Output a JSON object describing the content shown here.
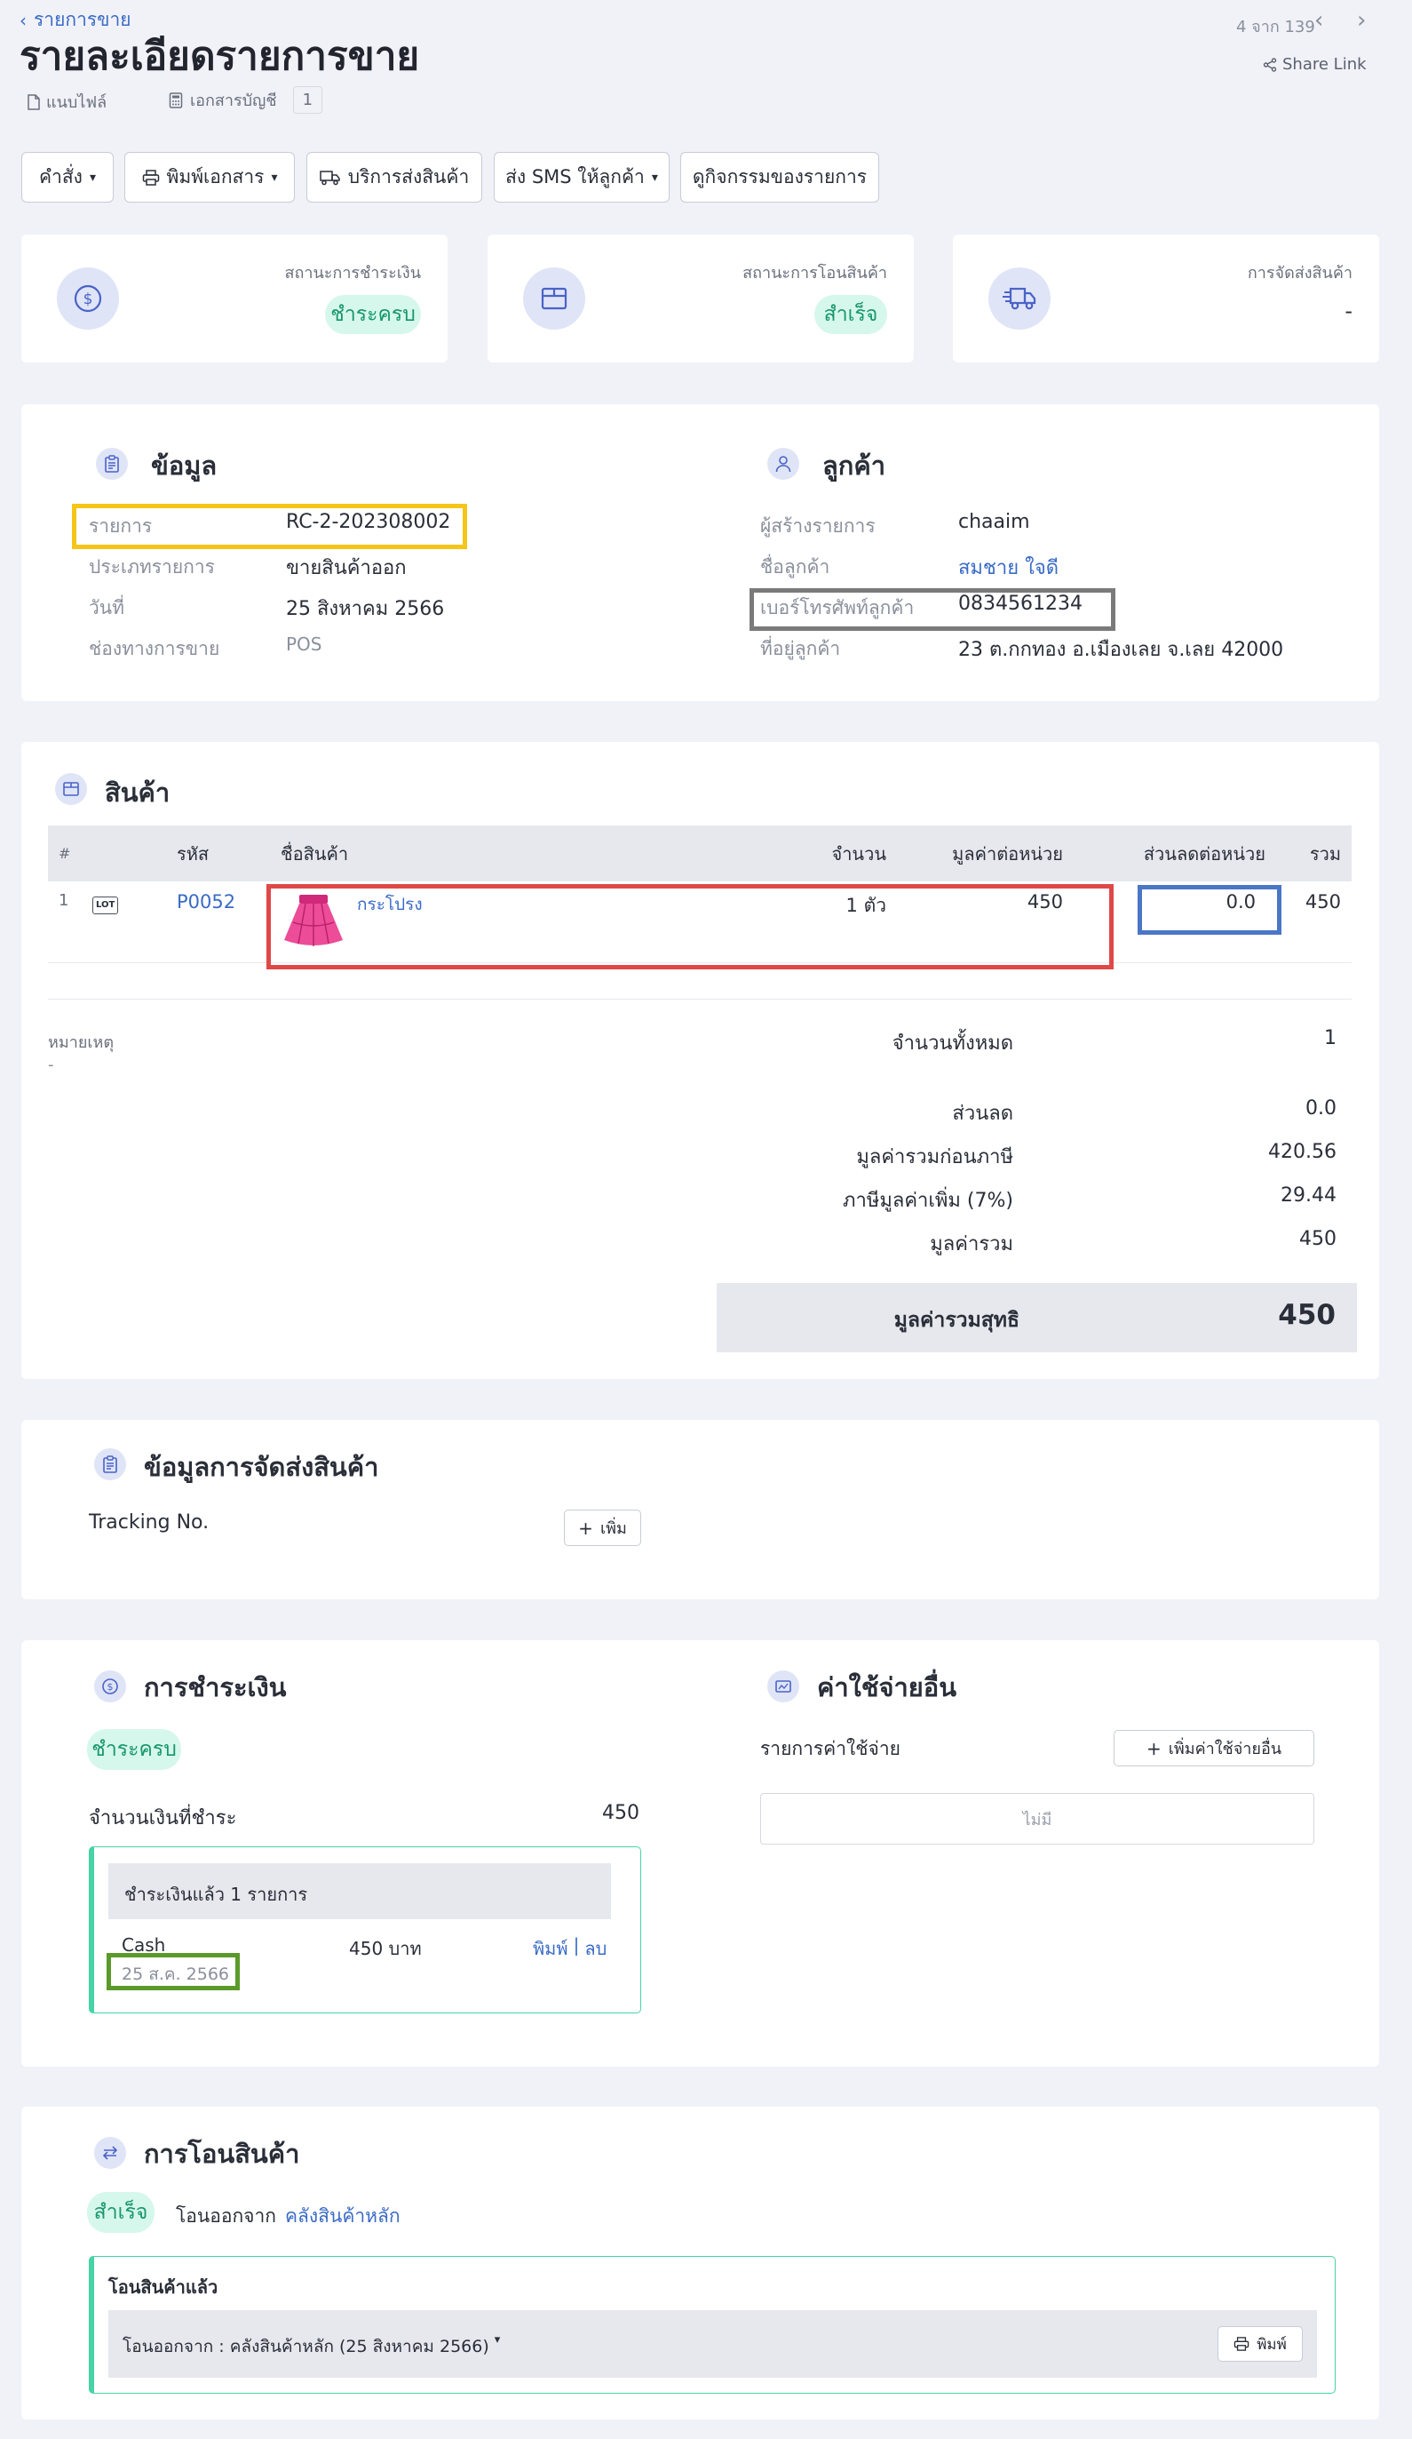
{
  "header": {
    "back_link": "รายการขาย",
    "title": "รายละเอียดรายการขาย",
    "attach_label": "แนบไฟล์",
    "accounting_label": "เอกสารบัญชี",
    "accounting_count": "1",
    "pager": "4 จาก 139",
    "share_link": "Share Link"
  },
  "toolbar": {
    "command": "คำสั่ง",
    "print_docs": "พิมพ์เอกสาร",
    "shipping_service": "บริการส่งสินค้า",
    "send_sms": "ส่ง SMS ให้ลูกค้า",
    "activity": "ดูกิจกรรมของรายการ"
  },
  "status_cards": [
    {
      "label": "สถานะการชำระเงิน",
      "value": "ชำระครบ",
      "icon": "dollar-icon"
    },
    {
      "label": "สถานะการโอนสินค้า",
      "value": "สำเร็จ",
      "icon": "box-icon"
    },
    {
      "label": "การจัดส่งสินค้า",
      "value": "-",
      "icon": "truck-icon"
    }
  ],
  "info": {
    "title": "ข้อมูล",
    "rows": [
      {
        "label": "รายการ",
        "value": "RC-2-202308002"
      },
      {
        "label": "ประเภทรายการ",
        "value": "ขายสินค้าออก"
      },
      {
        "label": "วันที่",
        "value": "25 สิงหาคม 2566"
      },
      {
        "label": "ช่องทางการขาย",
        "value": "POS"
      }
    ]
  },
  "customer": {
    "title": "ลูกค้า",
    "rows": [
      {
        "label": "ผู้สร้างรายการ",
        "value": "chaaim"
      },
      {
        "label": "ชื่อลูกค้า",
        "value": "สมชาย ใจดี"
      },
      {
        "label": "เบอร์โทรศัพท์ลูกค้า",
        "value": "0834561234"
      },
      {
        "label": "ที่อยู่ลูกค้า",
        "value": "23 ต.กกทอง อ.เมืองเลย จ.เลย 42000"
      }
    ]
  },
  "products": {
    "title": "สินค้า",
    "columns": [
      "#",
      "รหัส",
      "ชื่อสินค้า",
      "จำนวน",
      "มูลค่าต่อหน่วย",
      "ส่วนลดต่อหน่วย",
      "รวม"
    ],
    "rows": [
      {
        "index": "1",
        "lot": "LOT",
        "code": "P0052",
        "name": "กระโปรง",
        "qty": "1 ตัว",
        "unit_price": "450",
        "discount": "0.0",
        "total": "450"
      }
    ],
    "note_label": "หมายเหตุ",
    "note_value": "-",
    "summary": [
      {
        "label": "จำนวนทั้งหมด",
        "value": "1"
      },
      {
        "label": "ส่วนลด",
        "value": "0.0"
      },
      {
        "label": "มูลค่ารวมก่อนภาษี",
        "value": "420.56"
      },
      {
        "label": "ภาษีมูลค่าเพิ่ม (7%)",
        "value": "29.44"
      },
      {
        "label": "มูลค่ารวม",
        "value": "450"
      }
    ],
    "net_label": "มูลค่ารวมสุทธิ",
    "net_value": "450"
  },
  "shipping": {
    "title": "ข้อมูลการจัดส่งสินค้า",
    "tracking_label": "Tracking No.",
    "add_button": "เพิ่ม"
  },
  "payment": {
    "title": "การชำระเงิน",
    "status": "ชำระครบ",
    "amount_label": "จำนวนเงินที่ชำระ",
    "amount_value": "450",
    "paid_header": "ชำระเงินแล้ว 1 รายการ",
    "method": "Cash",
    "paid_amount": "450 บาท",
    "print_link": "พิมพ์",
    "separator": "|",
    "delete_link": "ลบ",
    "paid_date": "25 ส.ค. 2566"
  },
  "expenses": {
    "title": "ค่าใช้จ่ายอื่น",
    "list_label": "รายการค่าใช้จ่าย",
    "add_button": "เพิ่มค่าใช้จ่ายอื่น",
    "empty": "ไม่มี"
  },
  "transfer": {
    "title": "การโอนสินค้า",
    "status": "สำเร็จ",
    "from_prefix": "โอนออกจาก",
    "warehouse": "คลังสินค้าหลัก",
    "box_title": "โอนสินค้าแล้ว",
    "entry": "โอนออกจาก : คลังสินค้าหลัก (25 สิงหาคม 2566)",
    "print_button": "พิมพ์"
  },
  "colors": {
    "accent": "#3a6bc6",
    "success_bg": "#d6f7ec",
    "success_text": "#17966c",
    "highlight_yellow": "#f5c518",
    "highlight_gray": "#7a7a7a",
    "highlight_red": "#e04848",
    "highlight_blue": "#4a76c6",
    "highlight_green": "#5a9a2a"
  }
}
